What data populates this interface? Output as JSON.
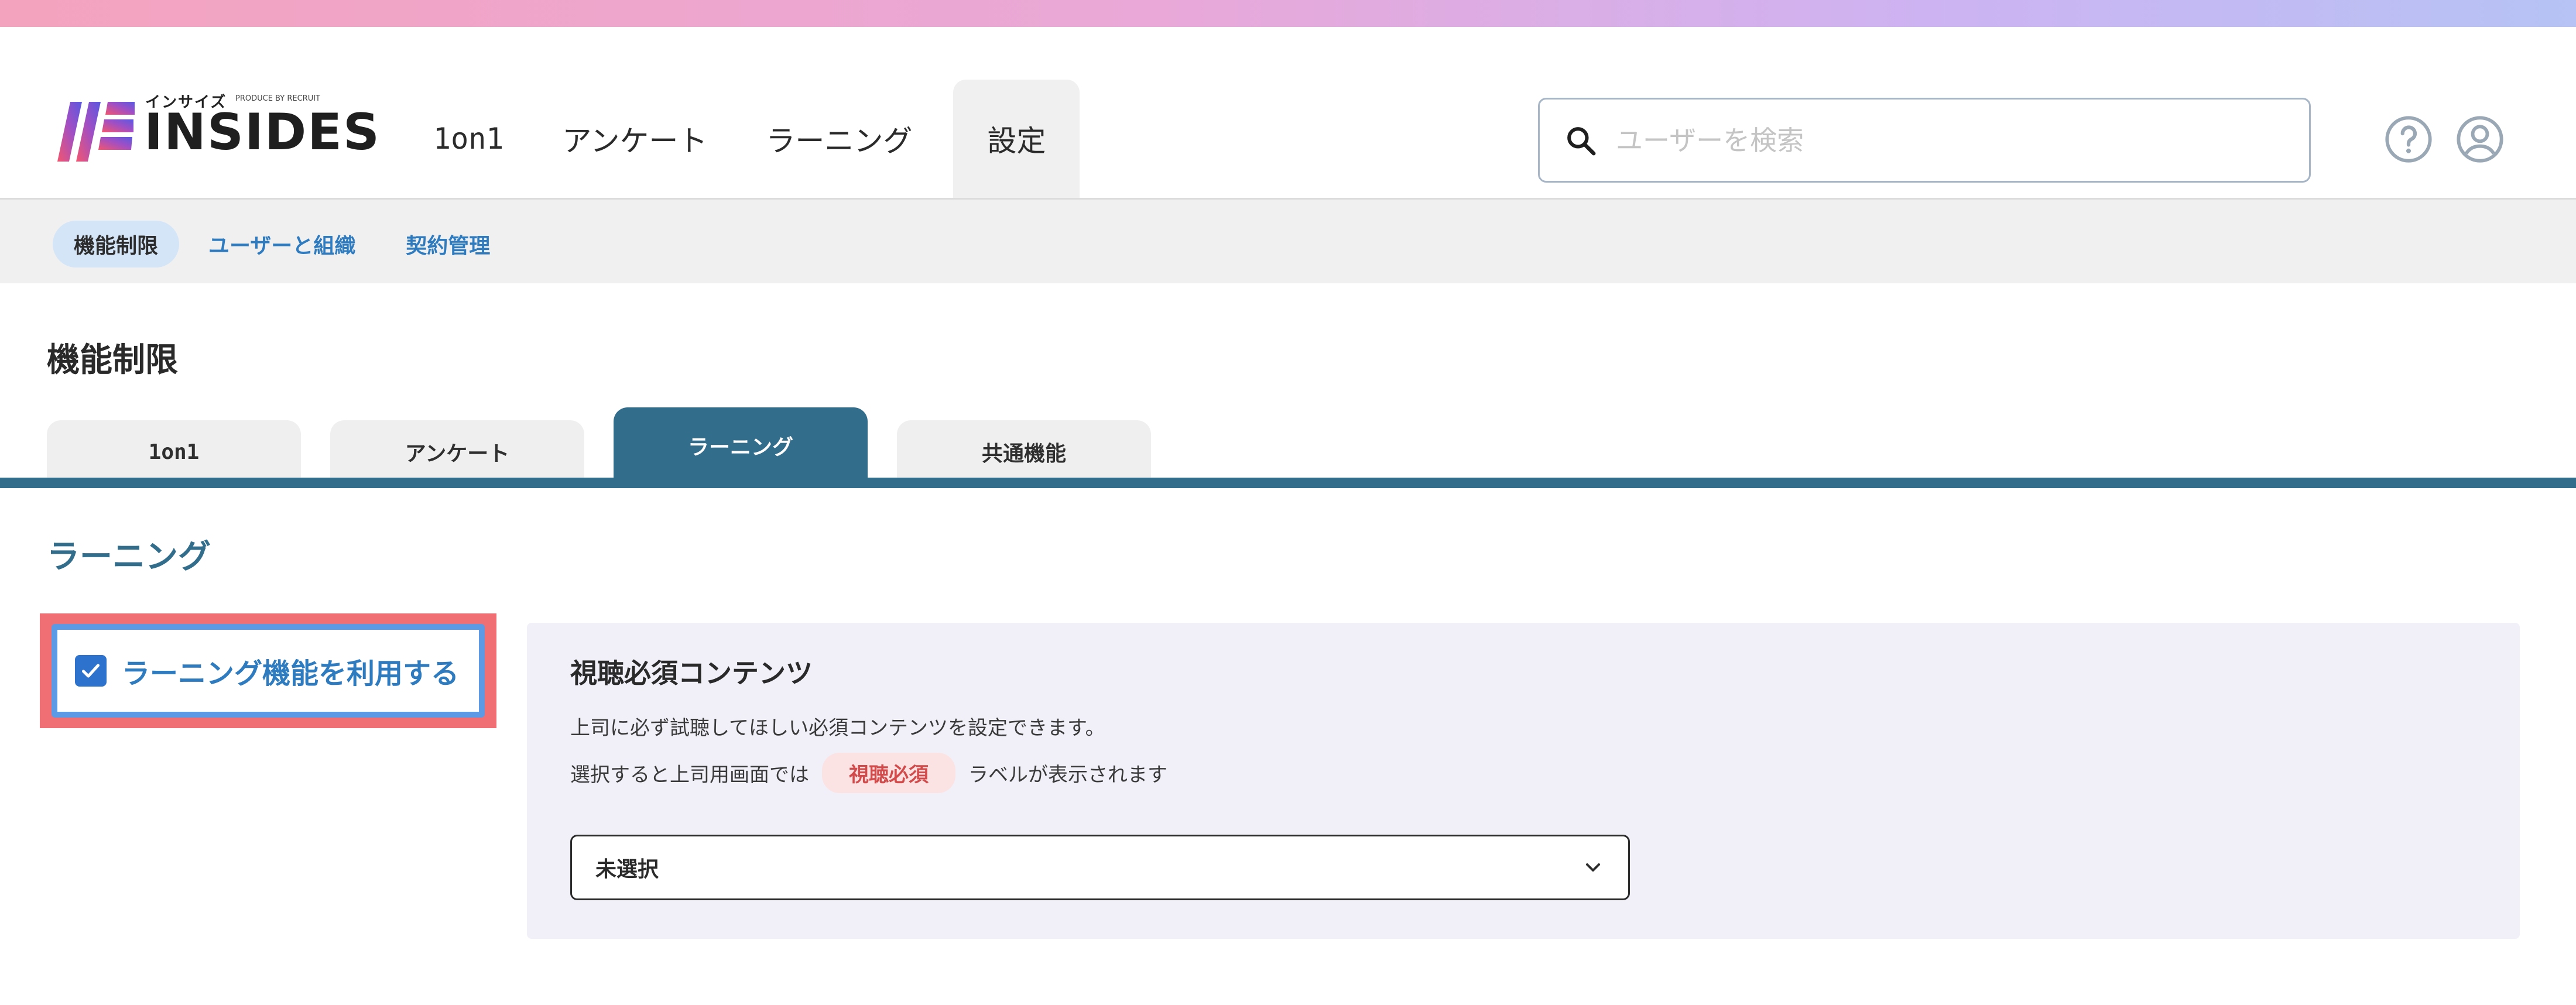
{
  "brand": {
    "name": "INSIDES",
    "kana": "インサイズ",
    "tagline": "PRODUCE BY RECRUIT",
    "colors": {
      "mark_start": "#f2566f",
      "mark_end": "#5a59e0"
    }
  },
  "header": {
    "nav": [
      {
        "label": "1on1"
      },
      {
        "label": "アンケート"
      },
      {
        "label": "ラーニング"
      },
      {
        "label": "設定",
        "active": true
      }
    ],
    "search": {
      "placeholder": "ユーザーを検索",
      "value": ""
    },
    "icons": {
      "help": "help-circle-icon",
      "account": "user-circle-icon"
    }
  },
  "subnav": {
    "items": [
      {
        "label": "機能制限",
        "active": true
      },
      {
        "label": "ユーザーと組織"
      },
      {
        "label": "契約管理"
      }
    ]
  },
  "page": {
    "title": "機能制限",
    "tabs": [
      {
        "label": "1on1"
      },
      {
        "label": "アンケート"
      },
      {
        "label": "ラーニング",
        "active": true
      },
      {
        "label": "共通機能"
      }
    ],
    "section_title": "ラーニング",
    "feature_toggle": {
      "label": "ラーニング機能を利用する",
      "checked": true
    },
    "required_content": {
      "title": "視聴必須コンテンツ",
      "description": "上司に必ず試聴してほしい必須コンテンツを設定できます。",
      "note_before": "選択すると上司用画面では",
      "badge": "視聴必須",
      "note_after": "ラベルが表示されます",
      "select_value": "未選択"
    }
  },
  "colors": {
    "accent": "#326d8c",
    "link": "#2e7bbf",
    "highlight": "#ef6f74",
    "checkbox": "#2d72cc",
    "badge_text": "#d24a4a",
    "badge_bg": "#fbe3e3"
  }
}
